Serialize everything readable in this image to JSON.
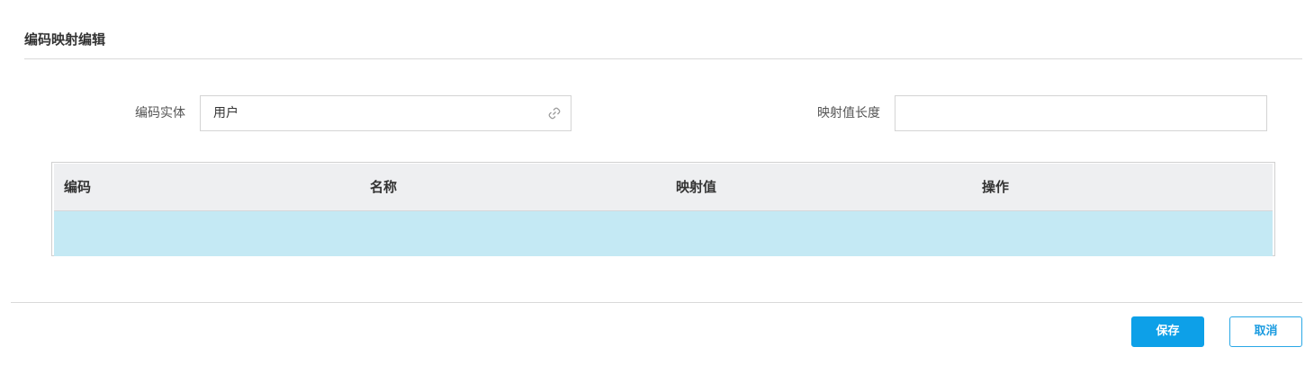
{
  "dialog": {
    "title": "编码映射编辑"
  },
  "form": {
    "entity_label": "编码实体",
    "entity_value": "用户",
    "entity_icon": "link-icon",
    "length_label": "映射值长度",
    "length_value": ""
  },
  "table": {
    "columns": [
      "编码",
      "名称",
      "映射值",
      "操作"
    ],
    "rows": [
      {
        "code": "",
        "name": "",
        "mapped_value": "",
        "actions": "",
        "selected": true
      }
    ],
    "header_bg": "#eeeff1",
    "selected_row_bg": "#c4e9f4"
  },
  "footer": {
    "save_label": "保存",
    "cancel_label": "取消",
    "save_color": "#0da0e8",
    "cancel_color": "#1a9be0"
  }
}
